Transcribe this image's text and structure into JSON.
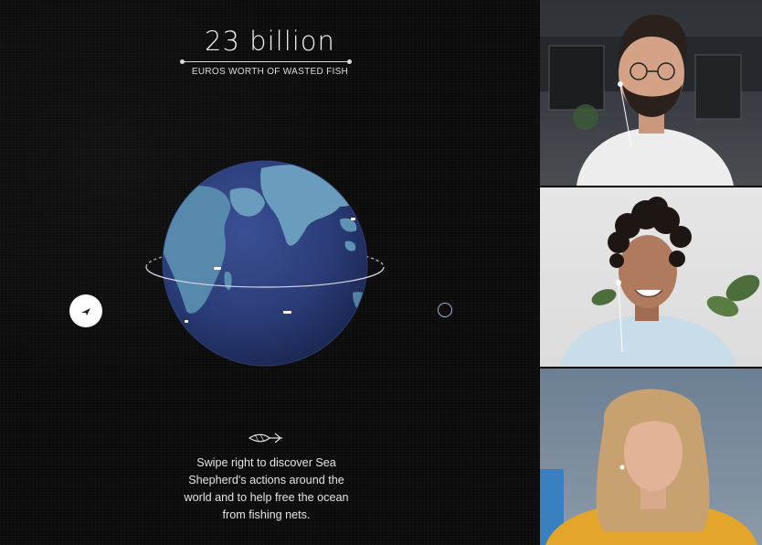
{
  "presentation": {
    "headline": "23 billion",
    "subhead": "EUROS WORTH OF WASTED FISH",
    "caption": "Swipe right to discover Sea Shepherd's actions around the world and to help free the ocean from fishing nets.",
    "globe_label": "globe-indian-ocean"
  },
  "participants": [
    {
      "position": 1,
      "appearance": "bearded man with glasses and earbuds, white sweater, dark room background"
    },
    {
      "position": 2,
      "appearance": "woman with curly hair and earbuds, light blue sweater, plant in background"
    },
    {
      "position": 3,
      "appearance": "woman with long blonde hair, yellow sweater, blue wall background"
    }
  ],
  "colors": {
    "background": "#0b0b0c",
    "globe_ocean": "#2b3d78",
    "globe_land": "#5a8fb0",
    "text": "#e4e4e4",
    "nav_ring": "#a9b2d6"
  }
}
